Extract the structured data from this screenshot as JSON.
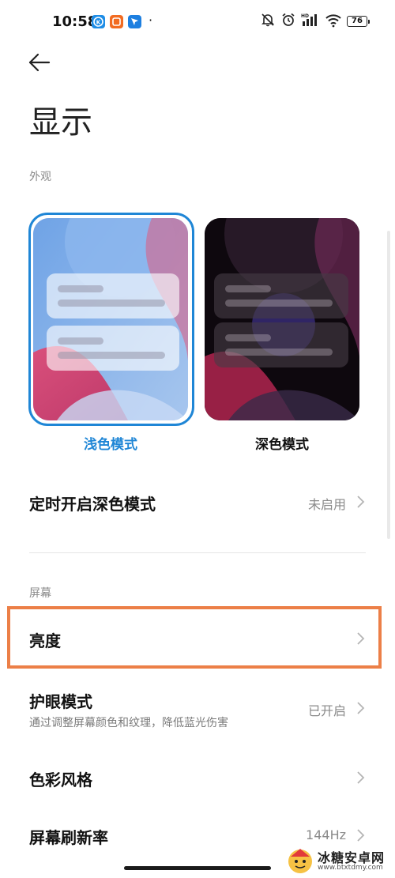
{
  "status_bar": {
    "time": "10:58",
    "app_icons": [
      "kuaishou-k-icon",
      "orange-app-icon",
      "blue-app-icon"
    ],
    "dot": "·",
    "battery": "76",
    "network_label": "HD"
  },
  "header": {
    "title": "显示"
  },
  "appearance": {
    "section_label": "外观",
    "light_label": "浅色模式",
    "dark_label": "深色模式",
    "selected": "light"
  },
  "schedule_dark": {
    "title": "定时开启深色模式",
    "value": "未启用"
  },
  "screen": {
    "section_label": "屏幕",
    "items": [
      {
        "title": "亮度",
        "value": ""
      },
      {
        "title": "护眼模式",
        "subtitle": "通过调整屏幕颜色和纹理，降低蓝光伤害",
        "value": "已开启"
      },
      {
        "title": "色彩风格",
        "value": ""
      },
      {
        "title": "屏幕刷新率",
        "value": "144Hz"
      }
    ]
  },
  "watermark": {
    "text": "冰糖安卓网",
    "url": "www.btxtdmy.com"
  },
  "colors": {
    "accent": "#1f86d6",
    "highlight": "#ec7f47"
  }
}
